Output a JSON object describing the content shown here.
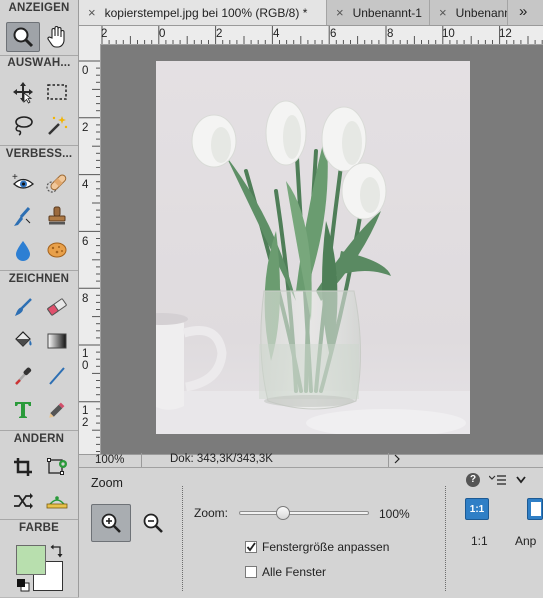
{
  "toolbar": {
    "sections": {
      "view": "ANZEIGEN",
      "select": "AUSWÄH...",
      "enhance": "VERBESS...",
      "draw": "ZEICHNEN",
      "modify": "ÄNDERN",
      "color": "FARBE"
    },
    "tools": [
      "zoom-tool",
      "hand-tool",
      "move-tool",
      "rectangular-marquee-tool",
      "lasso-tool",
      "magic-wand-tool",
      "red-eye-removal-tool",
      "spot-healing-brush-tool",
      "smart-brush-tool",
      "clone-stamp-tool",
      "blur-tool",
      "sponge-tool",
      "brush-tool",
      "eraser-tool",
      "paint-bucket-tool",
      "gradient-tool",
      "eyedropper-tool",
      "line-tool",
      "type-tool",
      "pencil-tool",
      "crop-tool",
      "recompose-tool",
      "content-aware-move-tool",
      "straighten-tool"
    ],
    "foreground_color": "#b8dfae",
    "background_color": "#ffffff"
  },
  "tabs": [
    {
      "label": "kopierstempel.jpg bei 100% (RGB/8) *",
      "active": true
    },
    {
      "label": "Unbenannt-1",
      "active": false
    },
    {
      "label": "Unbenannt",
      "active": false
    }
  ],
  "tab_overflow": "»",
  "rulers": {
    "top": [
      "2",
      "0",
      "2",
      "4",
      "6",
      "8",
      "10",
      "12"
    ],
    "left": [
      "0",
      "2",
      "4",
      "6",
      "8",
      "1\n0",
      "1\n2"
    ]
  },
  "status": {
    "zoom": "100%",
    "doc_info": "Dok: 343,3K/343,3K"
  },
  "options": {
    "title": "Zoom",
    "zoom_label": "Zoom:",
    "zoom_value": "100%",
    "zoom_level": 0.33,
    "resize_windows_label": "Fenstergröße anpassen",
    "resize_windows_checked": true,
    "all_windows_label": "Alle Fenster",
    "all_windows_checked": false,
    "one_to_one_label": "1:1",
    "one_to_one_caption": "1:1",
    "fit_caption": "Anp"
  }
}
